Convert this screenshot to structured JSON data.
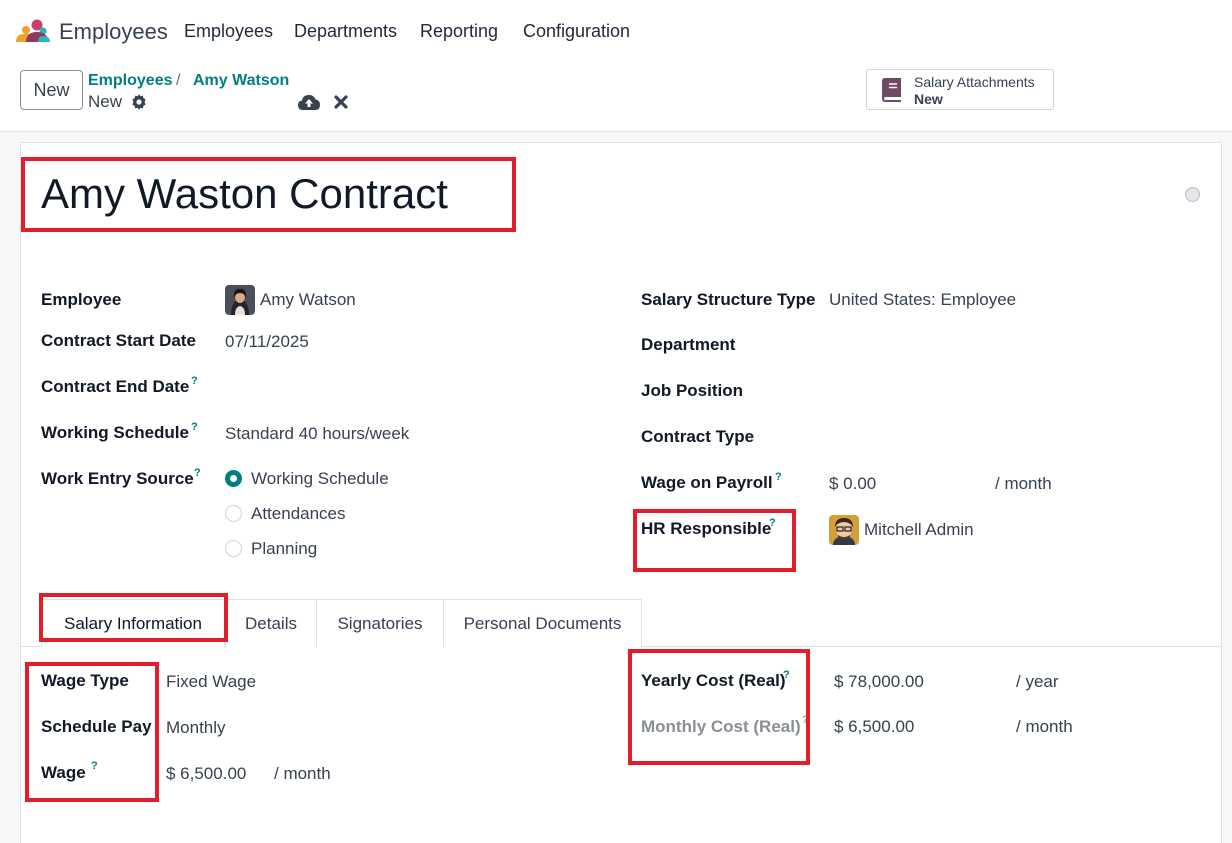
{
  "navbar": {
    "app_name": "Employees",
    "menu": [
      "Employees",
      "Departments",
      "Reporting",
      "Configuration"
    ]
  },
  "control": {
    "new_label": "New",
    "breadcrumb_parent": "Employees",
    "breadcrumb_sep": "/",
    "breadcrumb_current": "Amy Watson",
    "record_state": "New",
    "smart_button": {
      "title": "Salary Attachments",
      "value": "New",
      "icon": "book-icon"
    }
  },
  "form": {
    "title": "Amy Waston Contract",
    "left": {
      "employee_label": "Employee",
      "employee_value": "Amy Watson",
      "start_label": "Contract Start Date",
      "start_value": "07/11/2025",
      "end_label": "Contract End Date",
      "schedule_label": "Working Schedule",
      "schedule_value": "Standard 40 hours/week",
      "entry_label": "Work Entry Source",
      "entry_options": [
        "Working Schedule",
        "Attendances",
        "Planning"
      ],
      "entry_selected": "Working Schedule"
    },
    "right": {
      "structure_label": "Salary Structure Type",
      "structure_value": "United States: Employee",
      "department_label": "Department",
      "job_label": "Job Position",
      "type_label": "Contract Type",
      "wage_payroll_label": "Wage on Payroll",
      "wage_payroll_value": "$ 0.00",
      "wage_payroll_unit": "/ month",
      "hr_label": "HR Responsible",
      "hr_value": "Mitchell Admin"
    },
    "help_mark": "?"
  },
  "tabs": [
    "Salary Information",
    "Details",
    "Signatories",
    "Personal Documents"
  ],
  "salary": {
    "wage_type_label": "Wage Type",
    "wage_type_value": "Fixed Wage",
    "schedule_pay_label": "Schedule Pay",
    "schedule_pay_value": "Monthly",
    "wage_label": "Wage",
    "wage_value": "$ 6,500.00",
    "wage_unit": "/ month",
    "yearly_label": "Yearly Cost (Real)",
    "yearly_value": "$ 78,000.00",
    "yearly_unit": "/ year",
    "monthly_label": "Monthly Cost (Real)",
    "monthly_value": "$ 6,500.00",
    "monthly_unit": "/ month"
  },
  "colors": {
    "accent": "#017e84",
    "highlight": "#e21d2c"
  }
}
